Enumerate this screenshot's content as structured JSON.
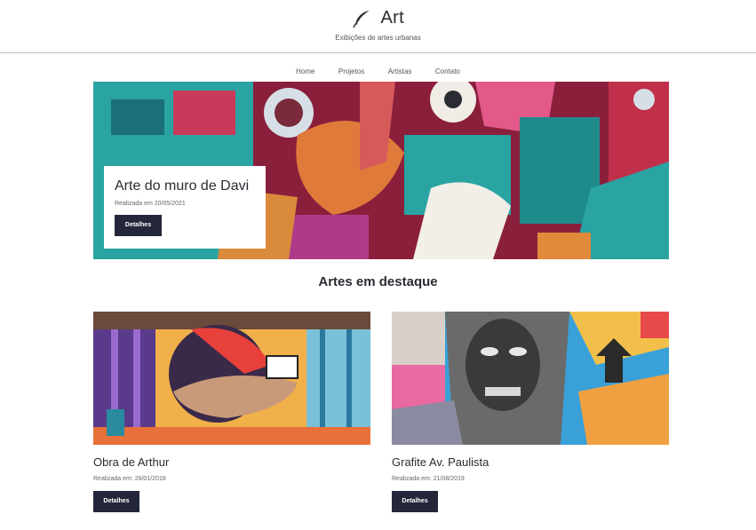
{
  "brand": {
    "title": "Art",
    "tagline": "Exibições de artes urbanas",
    "logo_icon": "feather-icon"
  },
  "nav": {
    "items": [
      "Home",
      "Projetos",
      "Artistas",
      "Contato"
    ]
  },
  "hero": {
    "title": "Arte do muro de Davi",
    "date": "Realizada em 20/05/2021",
    "button": "Detalhes"
  },
  "featured": {
    "title": "Artes em destaque",
    "cards": [
      {
        "title": "Obra de Arthur",
        "date": "Realizada em: 26/01/2018",
        "button": "Detalhes"
      },
      {
        "title": "Grafite Av. Paulista",
        "date": "Realizada em: 21/08/2019",
        "button": "Detalhes"
      }
    ]
  },
  "colors": {
    "button_bg": "#24273a",
    "text": "#2b2b33",
    "divider": "#bfbfbf"
  }
}
